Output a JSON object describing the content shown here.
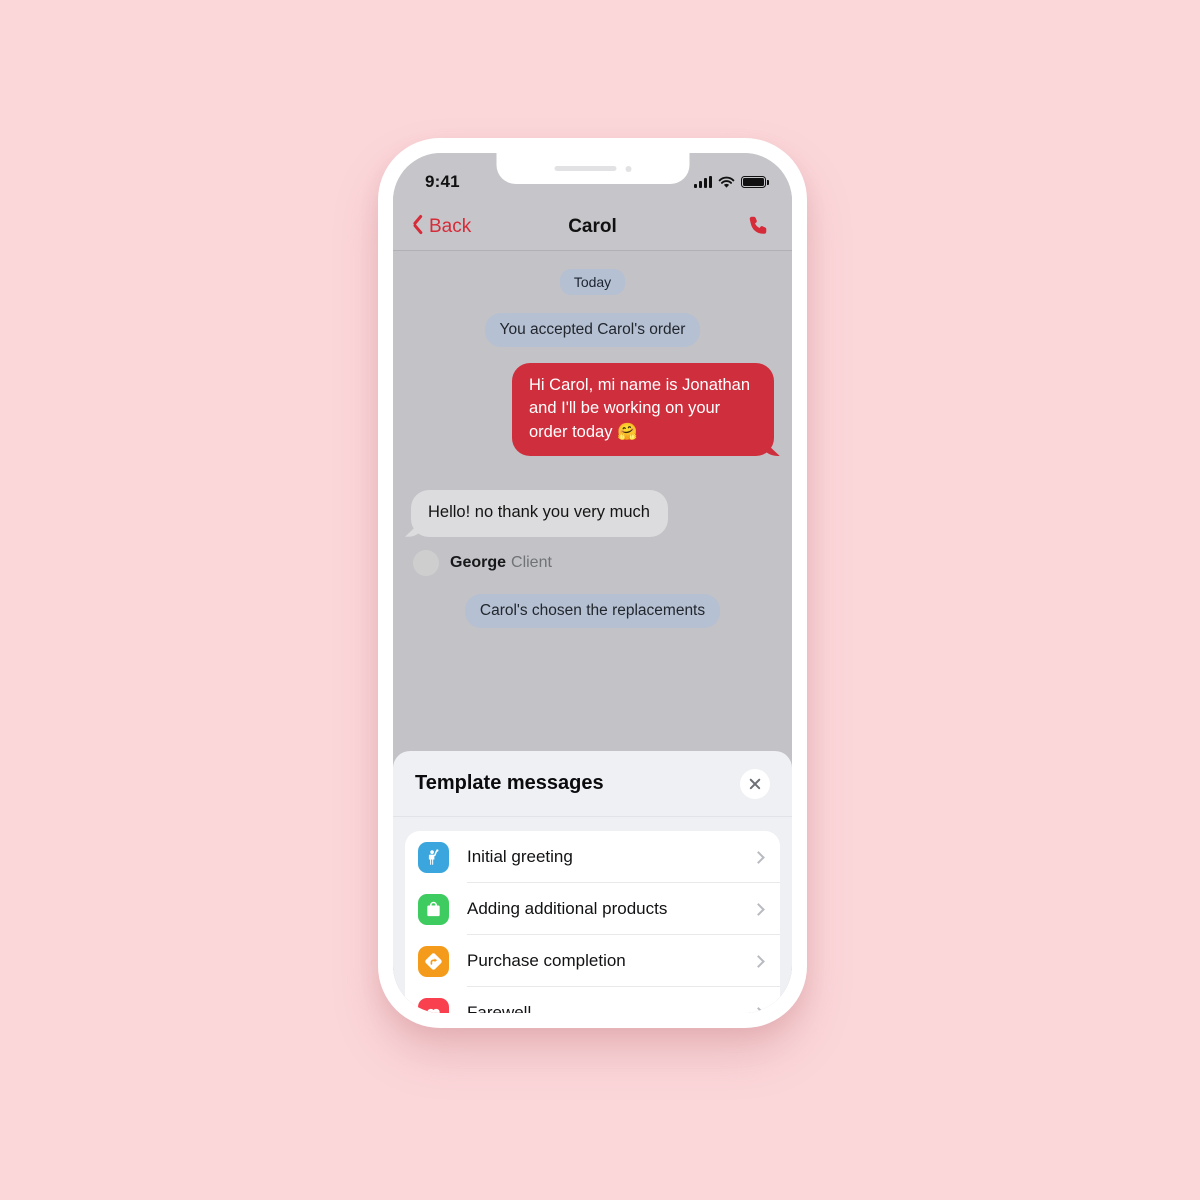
{
  "background_color": "#fbd7da",
  "status_bar": {
    "time": "9:41",
    "signal_icon": "cellular-signal-icon",
    "wifi_icon": "wifi-icon",
    "battery_icon": "battery-full-icon"
  },
  "nav_bar": {
    "back_label": "Back",
    "back_icon": "chevron-left-icon",
    "title": "Carol",
    "call_icon": "phone-call-icon",
    "accent_color": "#d62b39"
  },
  "chat": {
    "date_divider": "Today",
    "messages": [
      {
        "kind": "system",
        "text": "You accepted Carol's order"
      },
      {
        "kind": "outgoing",
        "text": "Hi Carol, mi name is Jonathan and I'll be working on your order today 🤗",
        "color": "#cf2e3c"
      },
      {
        "kind": "incoming",
        "text": "Hello! no thank you very much"
      },
      {
        "kind": "sender",
        "name": "George",
        "role": "Client"
      },
      {
        "kind": "system",
        "text": "Carol's chosen the replacements"
      }
    ]
  },
  "template_panel": {
    "title": "Template messages",
    "close_icon": "close-icon",
    "items": [
      {
        "label": "Initial greeting",
        "icon": "waving-person-icon",
        "icon_color": "#3aa6dd",
        "chevron": "chevron-right-icon"
      },
      {
        "label": "Adding additional products",
        "icon": "shopping-bag-icon",
        "icon_color": "#3ecb5f",
        "chevron": "chevron-right-icon"
      },
      {
        "label": "Purchase completion",
        "icon": "direction-sign-icon",
        "icon_color": "#f59b1b",
        "chevron": "chevron-right-icon"
      },
      {
        "label": "Farewell",
        "icon": "heart-icon",
        "icon_color": "#f8404f",
        "chevron": "chevron-right-icon"
      }
    ]
  }
}
